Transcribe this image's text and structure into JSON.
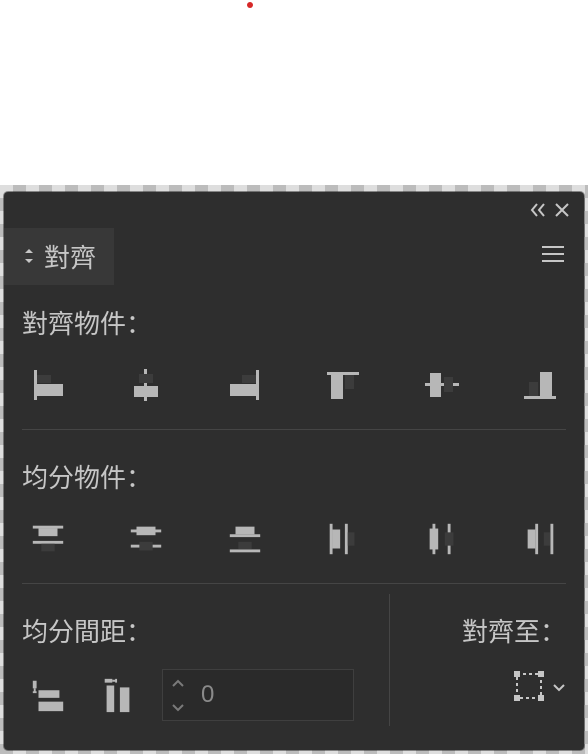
{
  "panel": {
    "tab_label": "對齊",
    "section1_label": "對齊物件：",
    "section2_label": "均分物件：",
    "section3_label": "均分間距：",
    "align_to_label": "對齊至：",
    "spacing_value": "0"
  }
}
